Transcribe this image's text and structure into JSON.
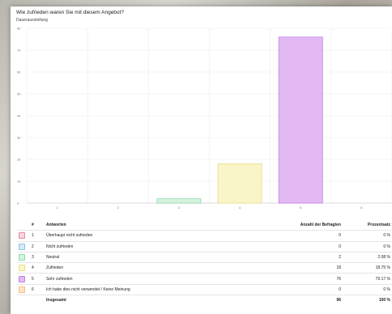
{
  "chart_data": {
    "type": "bar",
    "title": "Wie zufrieden waren Sie mit diesem Angebot?",
    "subtitle": "Dauerausstellung",
    "categories": [
      "1",
      "2",
      "3",
      "4",
      "5",
      "6"
    ],
    "values": [
      0,
      0,
      2,
      18,
      76,
      0
    ],
    "ylim": [
      0,
      80
    ],
    "yticks": [
      "0",
      "10",
      "20",
      "30",
      "40",
      "50",
      "60",
      "70",
      "80"
    ],
    "colors": [
      {
        "fill": "#f7d3dc",
        "stroke": "#e58aa0"
      },
      {
        "fill": "#d3e9f7",
        "stroke": "#8cc2e4"
      },
      {
        "fill": "#d4f3df",
        "stroke": "#8fd9aa"
      },
      {
        "fill": "#faf5c8",
        "stroke": "#e9dc8a"
      },
      {
        "fill": "#e3b9f4",
        "stroke": "#c680e6"
      },
      {
        "fill": "#fde6c8",
        "stroke": "#f0c07e"
      }
    ],
    "grid": true
  },
  "table": {
    "headers": {
      "no": "#",
      "answer": "Antworten",
      "count": "Anzahl der Befragten",
      "percent": "Prozentsatz"
    },
    "rows": [
      {
        "no": "1",
        "answer": "Überhaupt nicht zufrieden",
        "count": "0",
        "percent": "0 %"
      },
      {
        "no": "2",
        "answer": "Nicht zufrieden",
        "count": "0",
        "percent": "0 %"
      },
      {
        "no": "3",
        "answer": "Neutral",
        "count": "2",
        "percent": "2.08 %"
      },
      {
        "no": "4",
        "answer": "Zufrieden",
        "count": "18",
        "percent": "18.75 %"
      },
      {
        "no": "5",
        "answer": "Sehr zufrieden",
        "count": "76",
        "percent": "79.17 %"
      },
      {
        "no": "6",
        "answer": "Ich habe dies nicht verwendet / Keine Meinung",
        "count": "0",
        "percent": "0 %"
      }
    ],
    "total": {
      "label": "Insgesamt",
      "count": "96",
      "percent": "100 %"
    }
  }
}
